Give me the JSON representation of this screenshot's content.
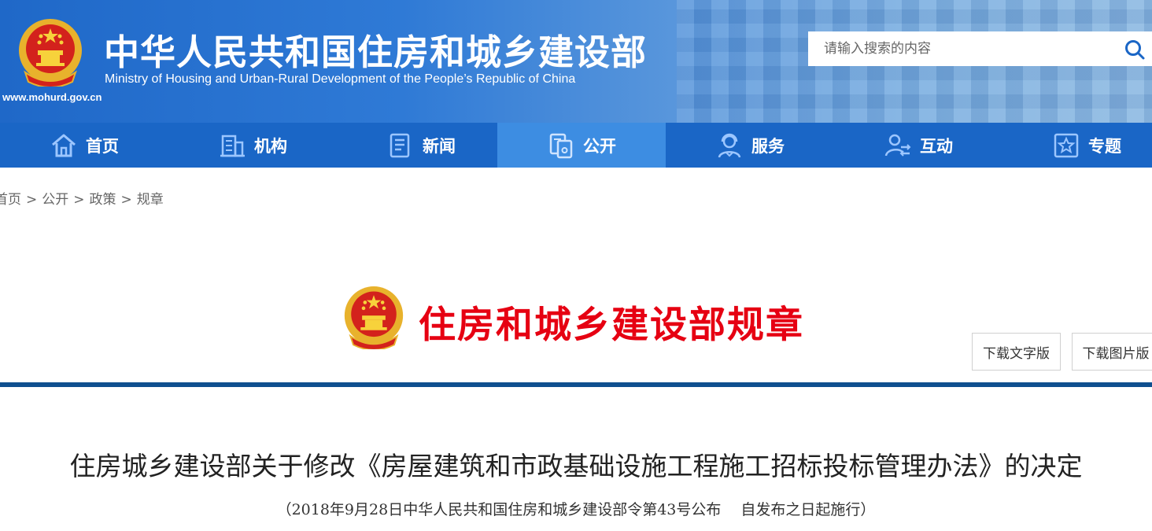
{
  "header": {
    "site_name_cn": "中华人民共和国住房和城乡建设部",
    "site_name_en": "Ministry of Housing and Urban-Rural Development of the People’s Republic of China",
    "site_url": "www.mohurd.gov.cn",
    "search": {
      "placeholder": "请输入搜索的内容",
      "value": ""
    }
  },
  "nav": {
    "items": [
      {
        "label": "首页",
        "icon": "home-icon"
      },
      {
        "label": "机构",
        "icon": "building-icon"
      },
      {
        "label": "新闻",
        "icon": "news-icon"
      },
      {
        "label": "公开",
        "icon": "documents-icon",
        "active": true
      },
      {
        "label": "服务",
        "icon": "service-person-icon"
      },
      {
        "label": "互动",
        "icon": "interaction-person-icon"
      },
      {
        "label": "专题",
        "icon": "star-box-icon"
      }
    ]
  },
  "breadcrumb": {
    "items": [
      "首页",
      "公开",
      "政策",
      "规章"
    ],
    "separator": ">"
  },
  "regulation": {
    "title": "住房和城乡建设部规章",
    "download_text_label": "下载文字版",
    "download_image_label": "下载图片版"
  },
  "document": {
    "title": "住房城乡建设部关于修改《房屋建筑和市政基础设施工程施工招标投标管理办法》的决定",
    "subtitle": "（2018年9月28日中华人民共和国住房和城乡建设部令第43号公布　 自发布之日起施行）"
  },
  "colors": {
    "header_blue": "#1f68c8",
    "nav_blue": "#1a66c6",
    "nav_active": "#3d8de2",
    "regulation_red": "#e60012",
    "divider": "#0f4f8f"
  }
}
